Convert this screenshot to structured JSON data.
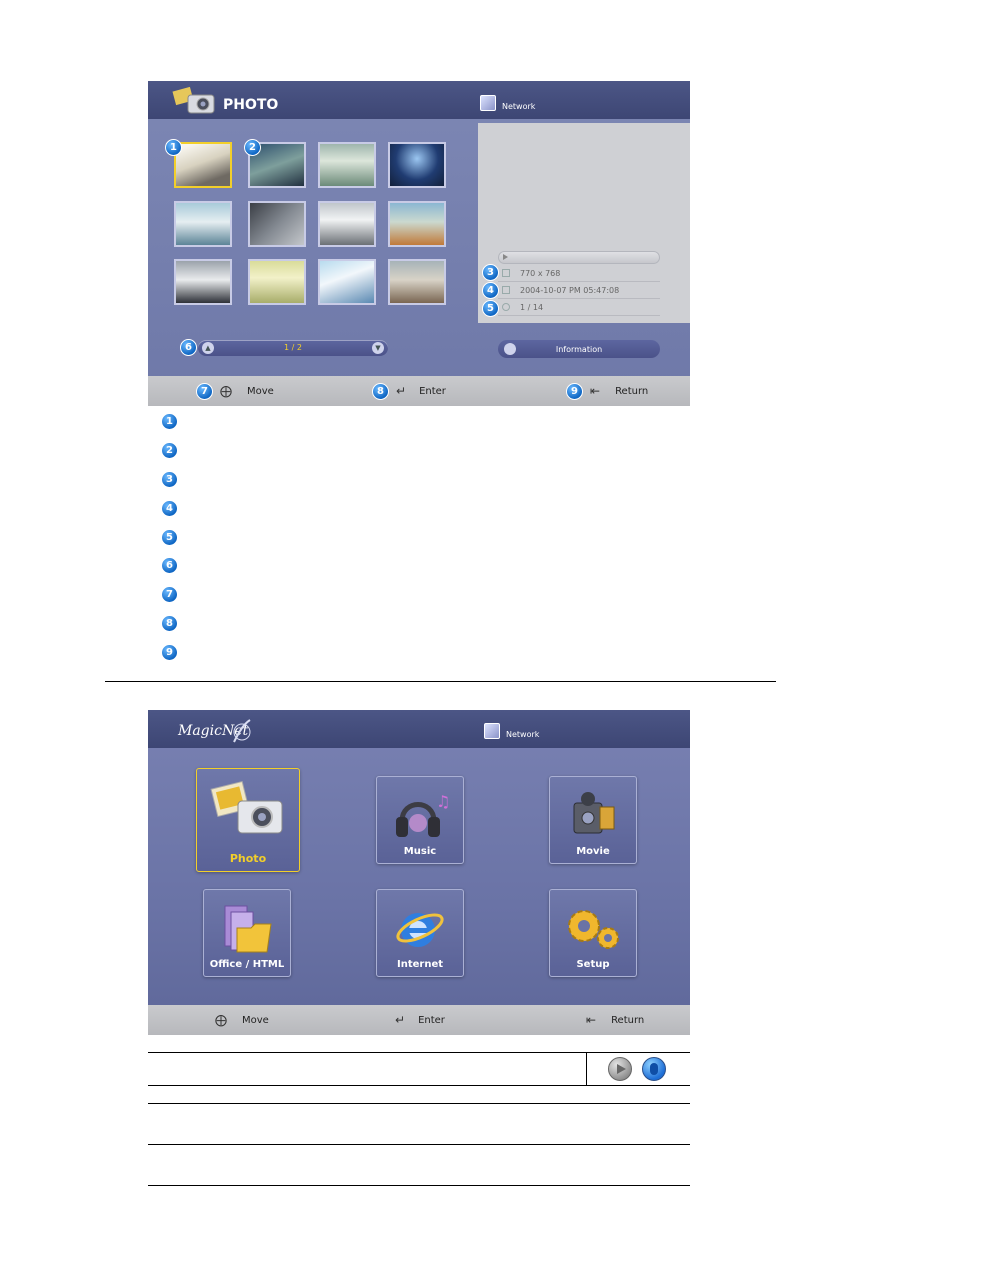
{
  "photo_screen": {
    "title": "PHOTO",
    "network_label": "Network",
    "thumbnail_badges": [
      "1",
      "2"
    ],
    "info": {
      "resolution": "770 x 768",
      "date": "2004-10-07 PM 05:47:08",
      "index": "1 / 14",
      "badges": [
        "3",
        "4",
        "5"
      ]
    },
    "page_indicator": "1 / 2",
    "page_badge": "6",
    "information_button": "Information",
    "bottom": {
      "move_label": "Move",
      "enter_label": "Enter",
      "return_label": "Return",
      "badges": [
        "7",
        "8",
        "9"
      ]
    }
  },
  "legend_badges": [
    "1",
    "2",
    "3",
    "4",
    "5",
    "6",
    "7",
    "8",
    "9"
  ],
  "main_screen": {
    "logo": "MagicNet",
    "network_label": "Network",
    "menu": [
      {
        "label": "Photo",
        "icon": "camera-icon",
        "selected": true
      },
      {
        "label": "Music",
        "icon": "headphones-icon",
        "selected": false
      },
      {
        "label": "Movie",
        "icon": "camcorder-icon",
        "selected": false
      },
      {
        "label": "Office / HTML",
        "icon": "folder-icon",
        "selected": false
      },
      {
        "label": "Internet",
        "icon": "internet-explorer-icon",
        "selected": false
      },
      {
        "label": "Setup",
        "icon": "gears-icon",
        "selected": false
      }
    ],
    "bottom": {
      "move_label": "Move",
      "enter_label": "Enter",
      "return_label": "Return"
    }
  },
  "colors": {
    "highlight": "#f2cf2a",
    "badge_blue": "#1067c4",
    "screen_bg": "#7078aa"
  }
}
